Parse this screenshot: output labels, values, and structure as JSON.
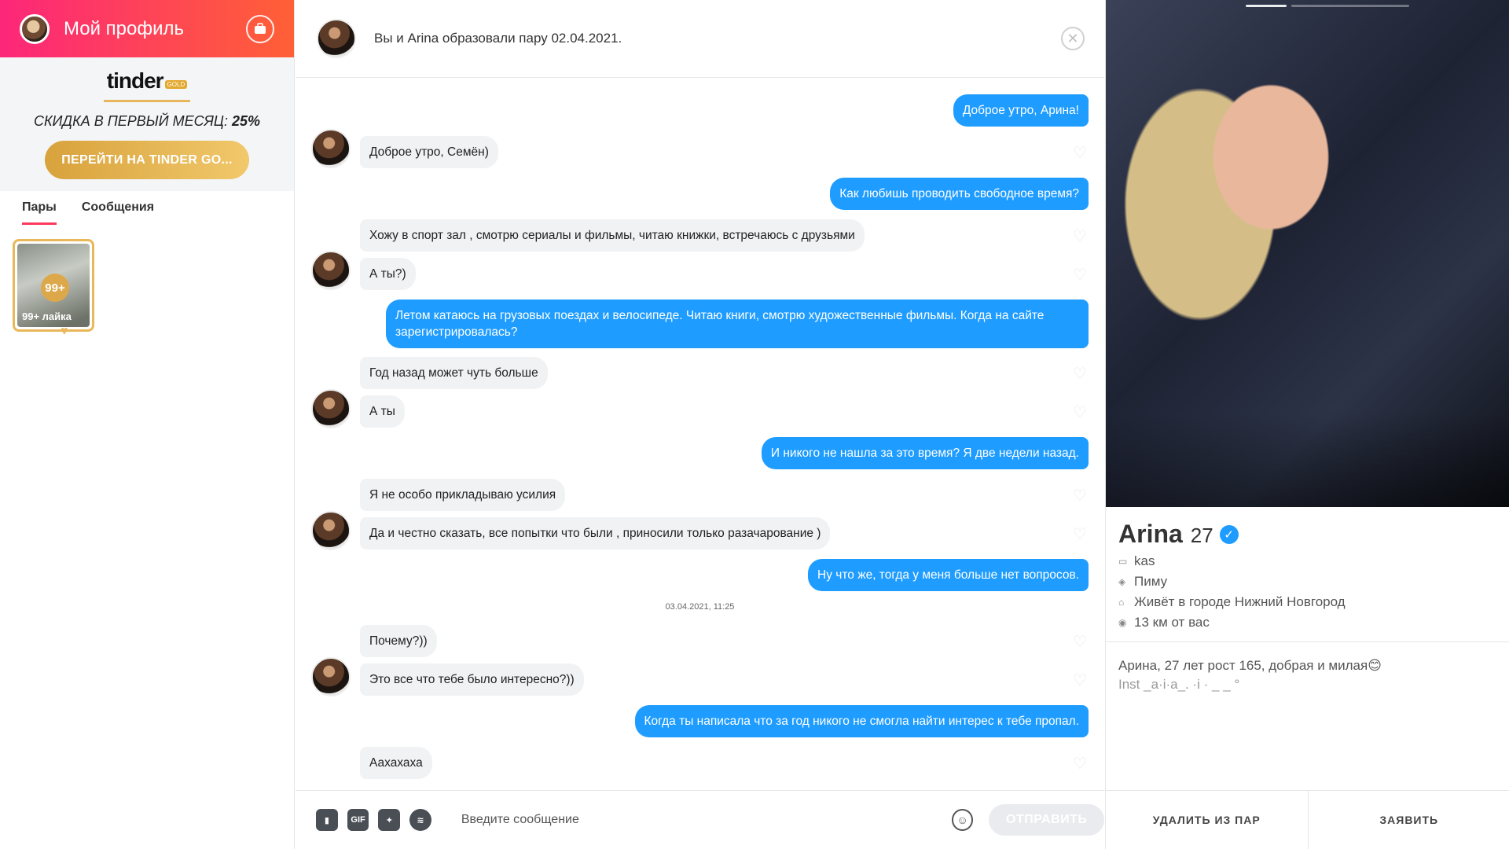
{
  "sidebar": {
    "header_title": "Мой профиль",
    "gold_logo": "tinder",
    "gold_badge": "GOLD",
    "discount_text": "СКИДКА В ПЕРВЫЙ МЕСЯЦ:",
    "discount_value": "25%",
    "gold_cta": "ПЕРЕЙТИ НА TINDER GO...",
    "tabs": [
      {
        "label": "Пары",
        "active": true
      },
      {
        "label": "Сообщения",
        "active": false
      }
    ],
    "likes_card": {
      "count_badge": "99+",
      "label": "99+ лайка"
    }
  },
  "chat": {
    "header_text": "Вы и Arina образовали пару 02.04.2021.",
    "messages": [
      {
        "dir": "out",
        "text": "Доброе утро, Арина!"
      },
      {
        "dir": "in",
        "text": "Доброе утро, Семён)"
      },
      {
        "dir": "out",
        "text": "Как любишь проводить свободное время?"
      },
      {
        "dir": "in",
        "text": "Хожу в спорт зал , смотрю сериалы и фильмы, читаю книжки, встречаюсь с друзьями"
      },
      {
        "dir": "in",
        "text": "А ты?)"
      },
      {
        "dir": "out",
        "text": "Летом катаюсь на грузовых поездах и велосипеде. Читаю книги, смотрю художественные фильмы. Когда на сайте зарегистрировалась?"
      },
      {
        "dir": "in",
        "text": "Год назад может чуть больше"
      },
      {
        "dir": "in",
        "text": "А ты"
      },
      {
        "dir": "out",
        "text": "И никого не нашла за это время? Я две недели назад."
      },
      {
        "dir": "in",
        "text": "Я не особо прикладываю усилия"
      },
      {
        "dir": "in",
        "text": "Да и честно сказать, все попытки что были , приносили только разачарование )"
      },
      {
        "dir": "out",
        "text": "Ну что же, тогда у меня больше нет вопросов."
      },
      {
        "dir": "in",
        "text": "Почему?))"
      },
      {
        "dir": "in",
        "text": "Это все что тебе было интересно?))"
      },
      {
        "dir": "out",
        "text": "Когда ты написала что за год никого не смогла найти интерес к тебе пропал."
      },
      {
        "dir": "in",
        "text": "Аахахаха"
      }
    ],
    "timestamp": "03.04.2021, 11:25",
    "composer": {
      "gif_label": "GIF",
      "placeholder": "Введите сообщение",
      "send_label": "ОТПРАВИТЬ"
    }
  },
  "profile": {
    "name": "Arina",
    "age": "27",
    "job": "kas",
    "school": "Пиму",
    "city": "Живёт в городе Нижний Новгород",
    "distance": "13 км от вас",
    "bio": "Арина, 27 лет рост 165, добрая и милая😊",
    "bio_inst": "Inst _a·i·a_.  ·i  ·  _  _ °",
    "actions": {
      "unmatch": "УДАЛИТЬ ИЗ ПАР",
      "report": "ЗАЯВИТЬ"
    }
  },
  "colors": {
    "header_gradient_start": "#fd267a",
    "header_gradient_end": "#ff6036",
    "gold": "#e3a82e",
    "outgoing_bubble": "#1e9cff",
    "incoming_bubble": "#f0f2f4",
    "verified": "#1e9cff"
  },
  "icons": [
    "briefcase-icon",
    "close-icon",
    "heart-icon",
    "contact-card-icon",
    "gif-icon",
    "sticker-icon",
    "spotify-icon",
    "emoji-icon",
    "verified-icon",
    "job-icon",
    "school-icon",
    "home-icon",
    "location-pin-icon"
  ]
}
